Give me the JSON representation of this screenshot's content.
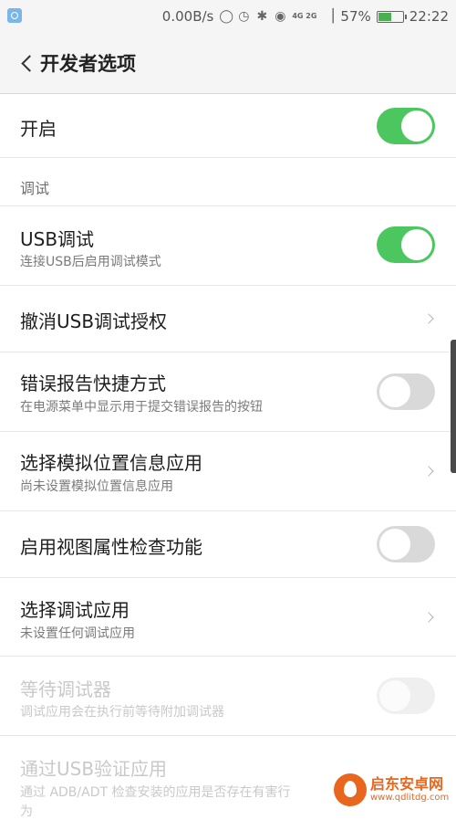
{
  "status_bar": {
    "speed": "0.00B/s",
    "network": "4G 2G",
    "battery_percent": "57%",
    "battery_level": 0.57,
    "time": "22:22"
  },
  "header": {
    "title": "开发者选项"
  },
  "rows": {
    "enable": {
      "label": "开启",
      "toggle": "on"
    },
    "section_debug": {
      "label": "调试"
    },
    "usb_debug": {
      "label": "USB调试",
      "sub": "连接USB后启用调试模式",
      "toggle": "on"
    },
    "revoke_usb": {
      "label": "撤消USB调试授权"
    },
    "bug_report": {
      "label": "错误报告快捷方式",
      "sub": "在电源菜单中显示用于提交错误报告的按钮",
      "toggle": "off"
    },
    "mock_location": {
      "label": "选择模拟位置信息应用",
      "sub": "尚未设置模拟位置信息应用"
    },
    "view_attr": {
      "label": "启用视图属性检查功能",
      "toggle": "off"
    },
    "debug_app": {
      "label": "选择调试应用",
      "sub": "未设置任何调试应用"
    },
    "wait_debugger": {
      "label": "等待调试器",
      "sub": "调试应用会在执行前等待附加调试器",
      "toggle": "disabled"
    },
    "verify_usb": {
      "label": "通过USB验证应用",
      "sub": "通过 ADB/ADT 检查安装的应用是否存在有害行",
      "sub_wrap": "为"
    }
  },
  "watermark": {
    "name": "启东安卓网",
    "url": "www.qdlitdg.com"
  },
  "colors": {
    "accent_green": "#4cc760",
    "watermark_orange": "#e9661f"
  }
}
